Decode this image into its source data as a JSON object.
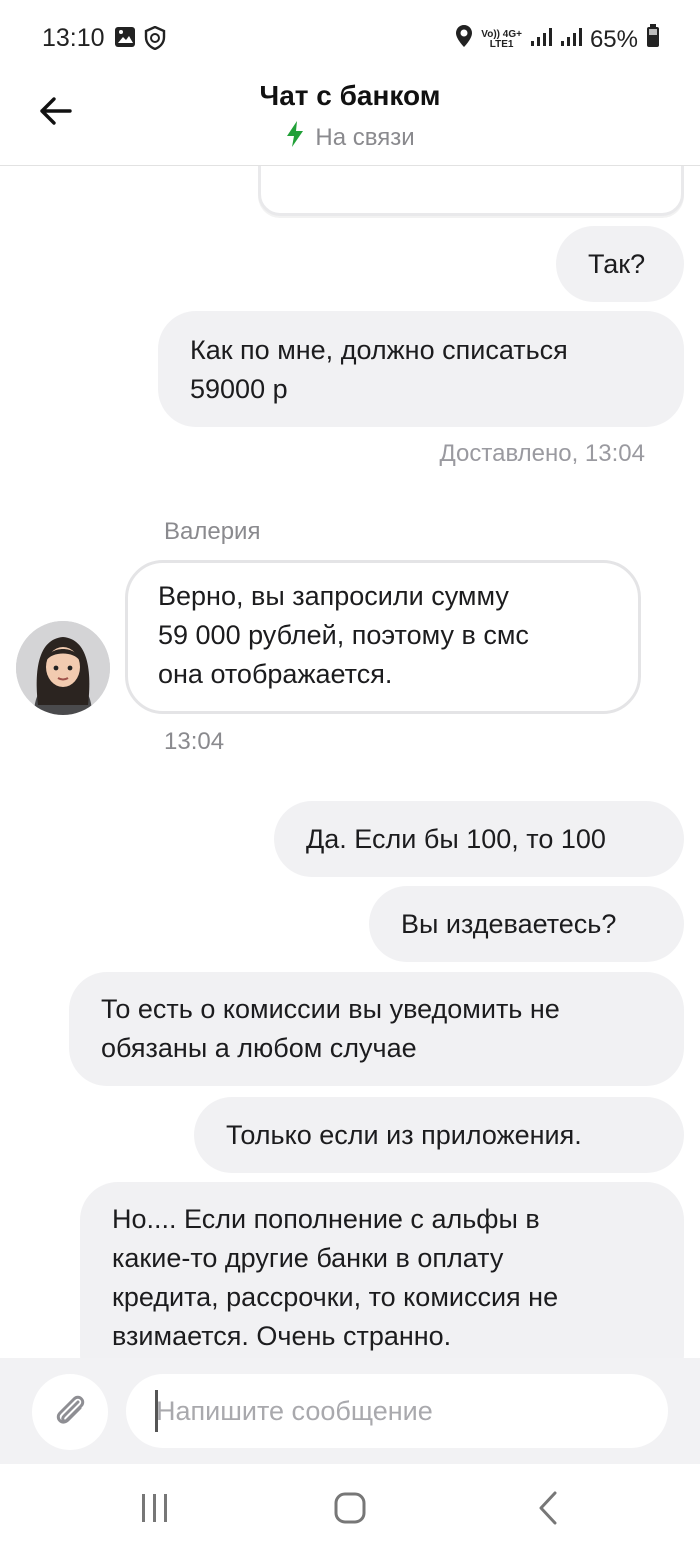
{
  "status_bar": {
    "time": "13:10",
    "battery": "65%",
    "network_top": "Vo)) 4G+",
    "network_bottom": "LTE1",
    "icons": [
      "image-icon",
      "shield-icon",
      "location-icon",
      "signal-icon",
      "signal-icon",
      "battery-icon"
    ]
  },
  "header": {
    "back_icon": "arrow-left-icon",
    "title": "Чат с банком",
    "status_icon": "lightning-icon",
    "status": "На связи",
    "status_icon_color": "#21a038"
  },
  "messages": {
    "m1": "Так?",
    "m2_line1": "Как по мне, должно списаться",
    "m2_line2": "59000 р",
    "delivered": "Доставлено, 13:04",
    "agent_name": "Валерия",
    "agent_line1": "Верно, вы запросили сумму",
    "agent_line2": "59 000 рублей, поэтому в смс",
    "agent_line3": "она отображается.",
    "agent_time": "13:04",
    "m3": "Да. Если бы 100, то 100",
    "m4": "Вы издеваетесь?",
    "m5_line1": "То есть о комиссии вы уведомить не",
    "m5_line2": "обязаны а любом случае",
    "m6": "Только если из приложения.",
    "m7_line1": "Но.... Если пополнение с альфы в",
    "m7_line2": "какие-то другие банки в оплату",
    "m7_line3": "кредита, рассрочки, то комиссия не",
    "m7_line4": "взимается. Очень странно."
  },
  "input": {
    "attach_icon": "paperclip-icon",
    "placeholder": "Напишите сообщение",
    "value": ""
  },
  "nav": {
    "icons": [
      "recent-apps-icon",
      "home-icon",
      "back-icon"
    ]
  },
  "colors": {
    "outgoing_bubble": "#f1f1f3",
    "incoming_border": "#e4e4e6",
    "accent_green": "#21a038"
  }
}
